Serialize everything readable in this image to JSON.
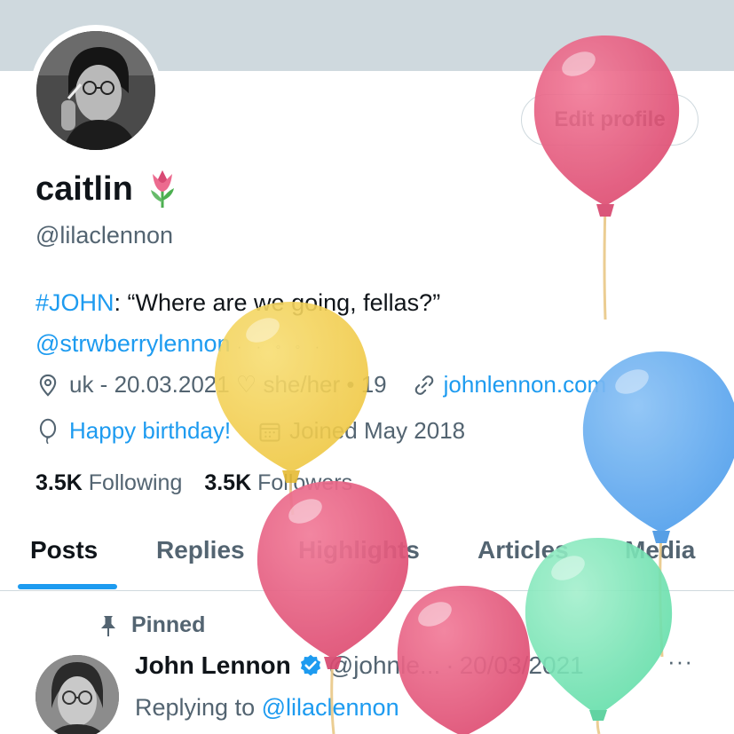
{
  "profile": {
    "edit_button": "Edit profile",
    "display_name": "caitlin",
    "handle": "@lilaclennon",
    "bio_hashtag": "#JOHN",
    "bio_text": ": “Where are we going, fellas?”",
    "bio_mention": "@strwberrylennon",
    "bio_dots": "· ·  ◦ ◦ ·",
    "location": "uk - 20.03.2021 ♡ she/her • 19",
    "website": "johnlennon.com",
    "birthday": "Happy birthday!",
    "joined": "Joined May 2018",
    "following_count": "3.5K",
    "following_label": "Following",
    "followers_count": "3.5K",
    "followers_label": "Followers"
  },
  "tabs": [
    {
      "label": "Posts",
      "active": true
    },
    {
      "label": "Replies"
    },
    {
      "label": "Highlights"
    },
    {
      "label": "Articles"
    },
    {
      "label": "Media"
    }
  ],
  "pinned_post": {
    "pinned_label": "Pinned",
    "author_name": "John Lennon",
    "author_handle": "@johnle...",
    "separator": "·",
    "date": "20/03/2021",
    "more": "···",
    "replying_prefix": "Replying to ",
    "replying_handle": "@lilaclennon"
  },
  "colors": {
    "accent": "#1d9bf0",
    "text": "#0f1419",
    "muted": "#536471",
    "border": "#cfd9de",
    "banner": "#cfd9de",
    "verified": "#1d9bf0",
    "balloon_red": "#e4557a",
    "balloon_yellow": "#f2cf4e",
    "balloon_blue": "#5ea8ef",
    "balloon_green": "#6fe3b2"
  },
  "icons": {
    "location": "location-pin-icon",
    "link": "link-icon",
    "birthday": "balloon-icon",
    "joined": "calendar-icon",
    "pinned": "pin-icon",
    "verified": "verified-badge-icon",
    "emoji": "tulip-emoji"
  }
}
